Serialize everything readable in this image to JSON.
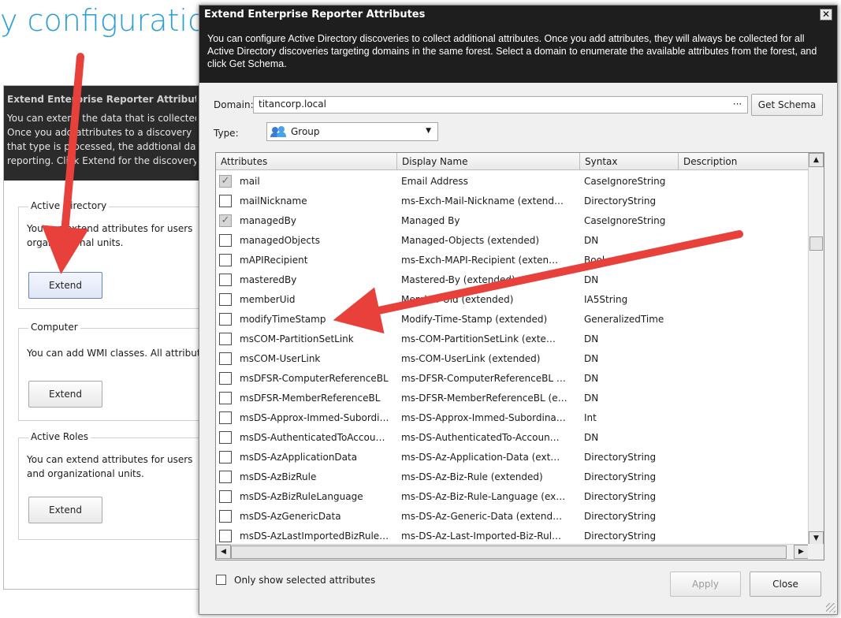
{
  "background": {
    "title_partial": "y configuratio",
    "panel": {
      "title": "Extend Enterprise Reporter Attributes",
      "lines": [
        "You can extend the data that is collected",
        "Once you add attributes to a discovery",
        "that type is processed, the addtional data",
        "reporting. Click Extend for the discovery"
      ]
    },
    "groups": [
      {
        "label": "Active Directory",
        "text_lines": [
          "You can extend attributes for users",
          "organizational units."
        ],
        "button": "Extend"
      },
      {
        "label": "Computer",
        "text_lines": [
          "You can add WMI classes. All attributes"
        ],
        "button": "Extend"
      },
      {
        "label": "Active Roles",
        "text_lines": [
          "You can extend attributes for users",
          "and organizational units."
        ],
        "button": "Extend"
      }
    ]
  },
  "dialog": {
    "title": "Extend Enterprise Reporter Attributes",
    "close_glyph": "✕",
    "description": "You can configure Active Directory discoveries to collect additional attributes. Once you add attributes, they will always be collected for all Active Directory discoveries targeting domains in the same forest. Select a domain to enumerate the available attributes from the forest, and click Get Schema.",
    "domain_label": "Domain:",
    "domain_value": "titancorp.local",
    "ellipsis": "···",
    "get_schema": "Get Schema",
    "type_label": "Type:",
    "type_value": "Group",
    "columns": [
      "Attributes",
      "Display Name",
      "Syntax",
      "Description"
    ],
    "rows": [
      {
        "attr": "mail",
        "display": "Email Address",
        "syntax": "CaseIgnoreString",
        "checked": true
      },
      {
        "attr": "mailNickname",
        "display": "ms-Exch-Mail-Nickname (extend…",
        "syntax": "DirectoryString",
        "checked": false
      },
      {
        "attr": "managedBy",
        "display": "Managed By",
        "syntax": "CaseIgnoreString",
        "checked": true
      },
      {
        "attr": "managedObjects",
        "display": "Managed-Objects (extended)",
        "syntax": "DN",
        "checked": false
      },
      {
        "attr": "mAPIRecipient",
        "display": "ms-Exch-MAPI-Recipient (exten…",
        "syntax": "Bool",
        "checked": false
      },
      {
        "attr": "masteredBy",
        "display": "Mastered-By (extended)",
        "syntax": "DN",
        "checked": false
      },
      {
        "attr": "memberUid",
        "display": "Member-Uid (extended)",
        "syntax": "IA5String",
        "checked": false
      },
      {
        "attr": "modifyTimeStamp",
        "display": "Modify-Time-Stamp (extended)",
        "syntax": "GeneralizedTime",
        "checked": false
      },
      {
        "attr": "msCOM-PartitionSetLink",
        "display": "ms-COM-PartitionSetLink (exte…",
        "syntax": "DN",
        "checked": false
      },
      {
        "attr": "msCOM-UserLink",
        "display": "ms-COM-UserLink (extended)",
        "syntax": "DN",
        "checked": false
      },
      {
        "attr": "msDFSR-ComputerReferenceBL",
        "display": "ms-DFSR-ComputerReferenceBL …",
        "syntax": "DN",
        "checked": false
      },
      {
        "attr": "msDFSR-MemberReferenceBL",
        "display": "ms-DFSR-MemberReferenceBL (e…",
        "syntax": "DN",
        "checked": false
      },
      {
        "attr": "msDS-Approx-Immed-Subordi…",
        "display": "ms-DS-Approx-Immed-Subordina…",
        "syntax": "Int",
        "checked": false
      },
      {
        "attr": "msDS-AuthenticatedToAccou…",
        "display": "ms-DS-AuthenticatedTo-Accoun…",
        "syntax": "DN",
        "checked": false
      },
      {
        "attr": "msDS-AzApplicationData",
        "display": "ms-DS-Az-Application-Data (ext…",
        "syntax": "DirectoryString",
        "checked": false
      },
      {
        "attr": "msDS-AzBizRule",
        "display": "ms-DS-Az-Biz-Rule (extended)",
        "syntax": "DirectoryString",
        "checked": false
      },
      {
        "attr": "msDS-AzBizRuleLanguage",
        "display": "ms-DS-Az-Biz-Rule-Language (ex…",
        "syntax": "DirectoryString",
        "checked": false
      },
      {
        "attr": "msDS-AzGenericData",
        "display": "ms-DS-Az-Generic-Data (extend…",
        "syntax": "DirectoryString",
        "checked": false
      },
      {
        "attr": "msDS-AzLastImportedBizRule…",
        "display": "ms-DS-Az-Last-Imported-Biz-Rul…",
        "syntax": "DirectoryString",
        "checked": false
      }
    ],
    "only_selected_label": "Only show selected attributes",
    "apply": "Apply",
    "close": "Close"
  },
  "colors": {
    "annotation_arrow": "#e8403a",
    "title_blue": "#2a9fd6",
    "dark_header": "#1e1e1e"
  }
}
